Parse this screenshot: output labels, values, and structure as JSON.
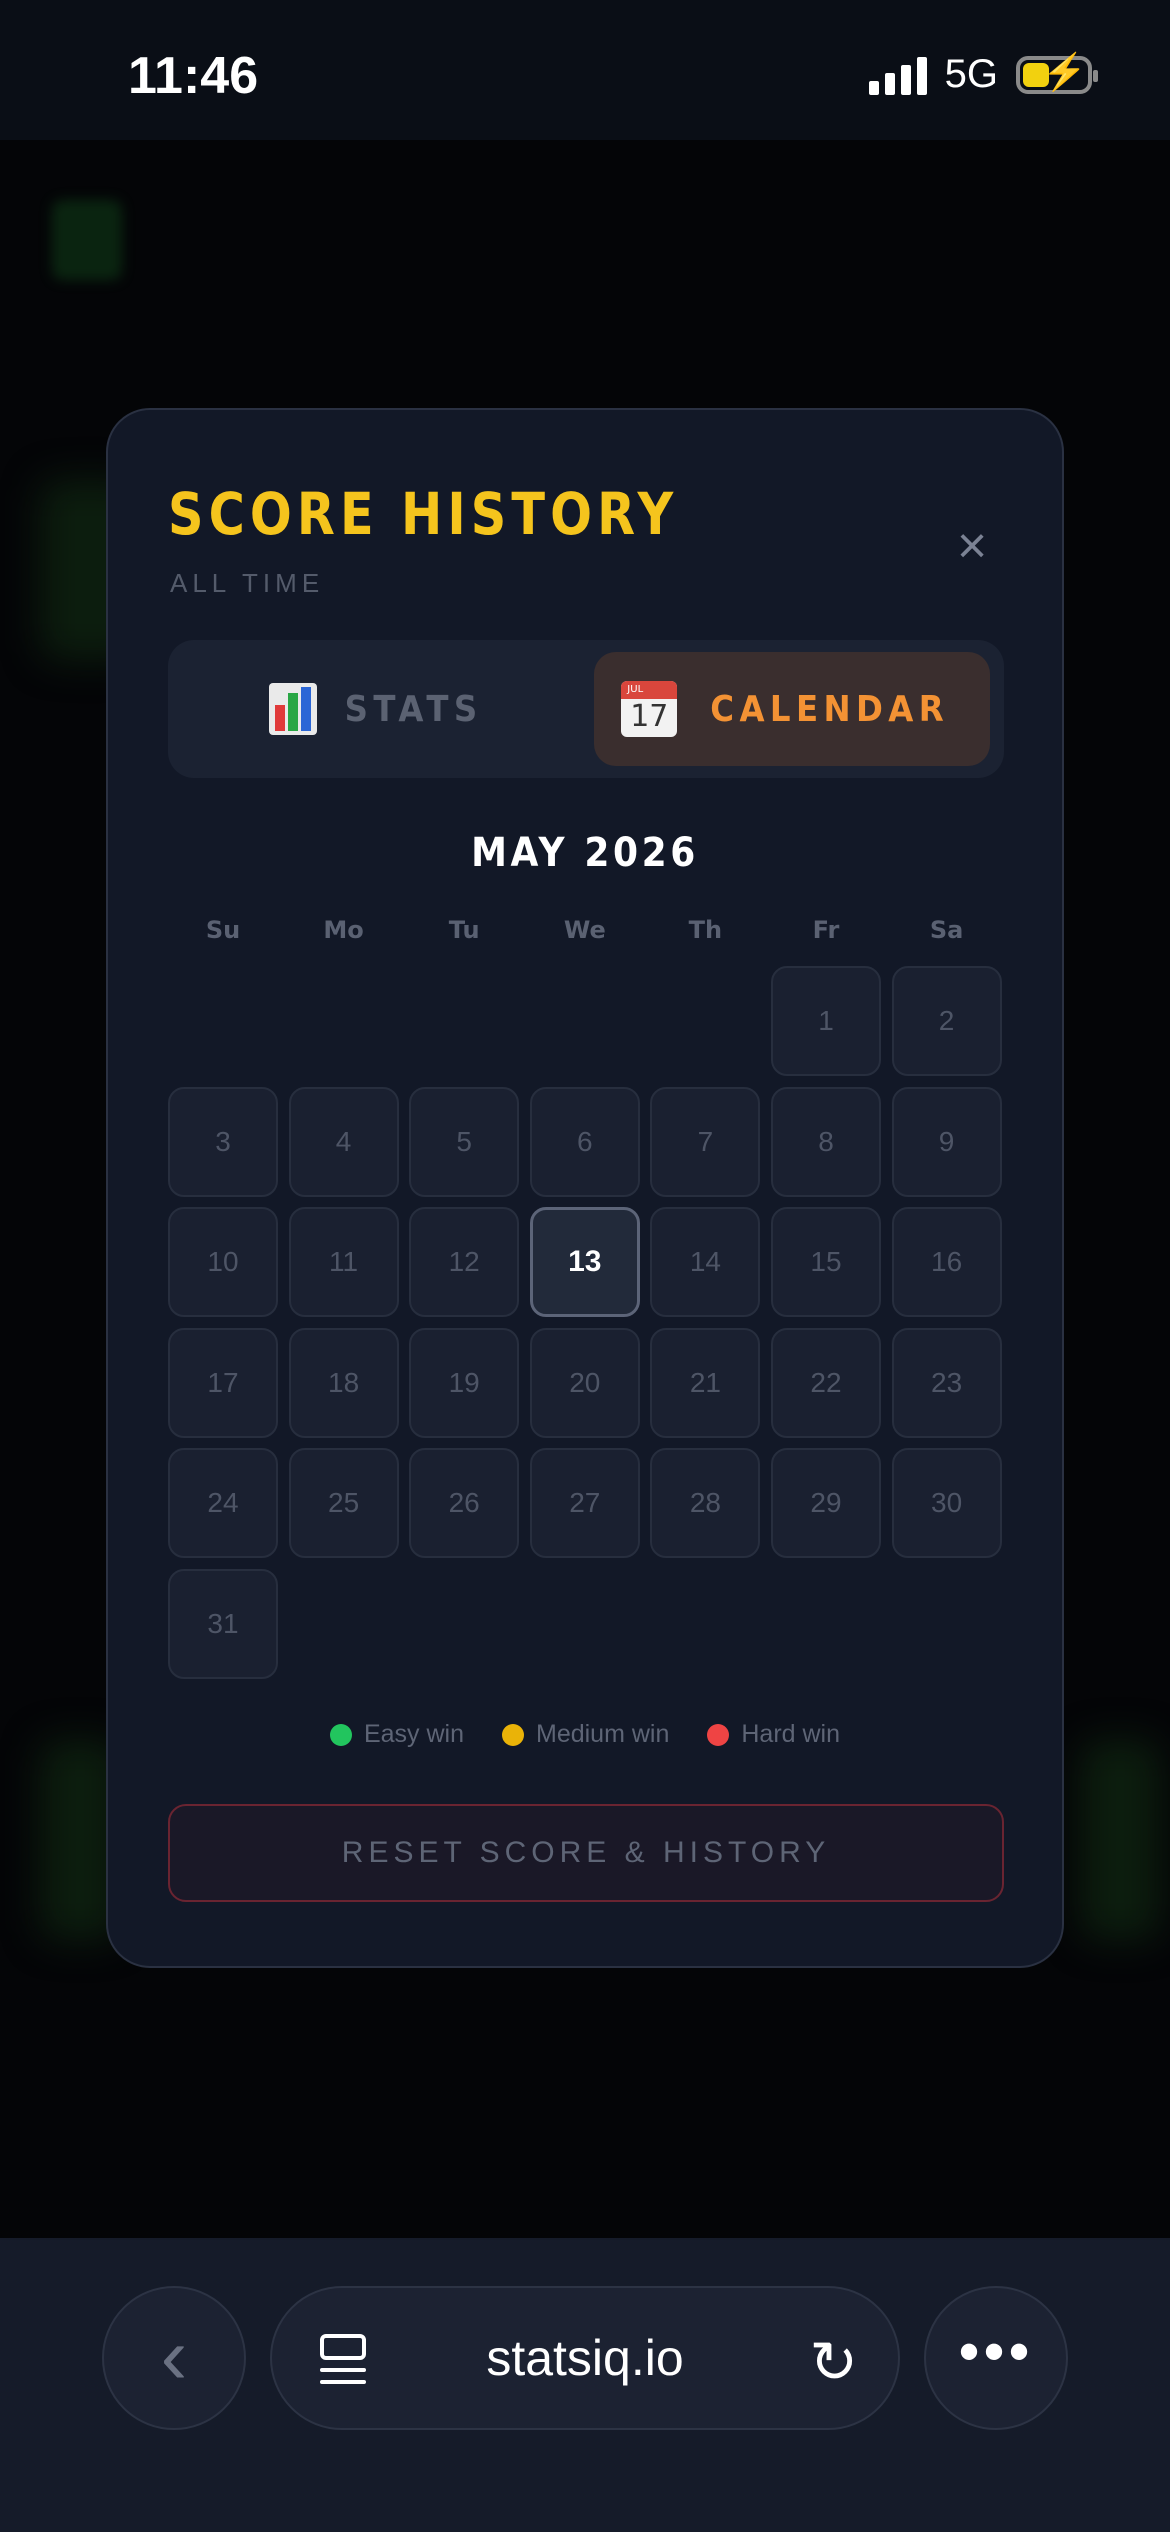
{
  "status_bar": {
    "time": "11:46",
    "network": "5G"
  },
  "modal": {
    "title": "SCORE HISTORY",
    "subtitle": "ALL TIME",
    "close_icon": "×",
    "tabs": [
      {
        "label": "STATS",
        "icon": "bar-chart-icon",
        "active": false
      },
      {
        "label": "CALENDAR",
        "icon": "calendar-icon",
        "active": true,
        "icon_top_text": "JUL",
        "icon_number": "17"
      }
    ],
    "month_title": "MAY 2026",
    "weekdays": [
      "Su",
      "Mo",
      "Tu",
      "We",
      "Th",
      "Fr",
      "Sa"
    ],
    "first_weekday_index": 5,
    "days_in_month": 31,
    "today": 13,
    "legend": [
      {
        "label": "Easy win",
        "color": "#22c55e"
      },
      {
        "label": "Medium win",
        "color": "#eab308"
      },
      {
        "label": "Hard win",
        "color": "#ef4444"
      }
    ],
    "reset_label": "RESET SCORE & HISTORY"
  },
  "browser": {
    "url": "statsiq.io",
    "back_icon": "‹",
    "reload_icon": "↻",
    "more_icon": "•••"
  }
}
